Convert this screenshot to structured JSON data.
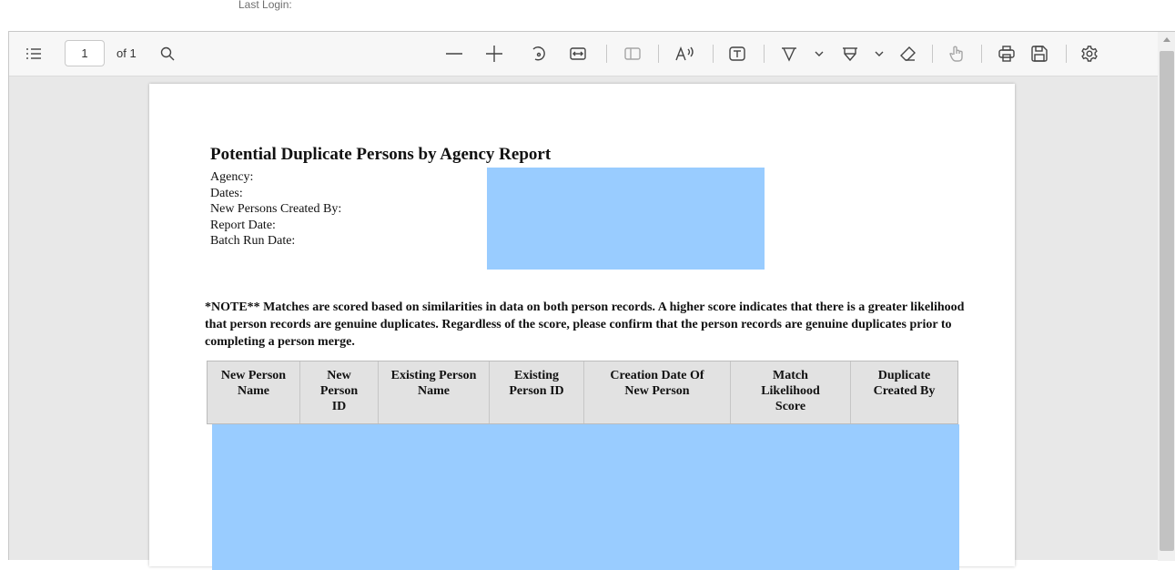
{
  "top": {
    "last_login_label": "Last Login:"
  },
  "toolbar": {
    "page_number": "1",
    "page_of": "of 1",
    "colors": {
      "toolbar_bg": "#f7f7f7",
      "viewer_bg": "#e8e8e8",
      "redaction": "#99ccff"
    },
    "icons": [
      "contents-icon",
      "search-icon",
      "zoom-out-icon",
      "zoom-in-icon",
      "rotate-icon",
      "fit-width-icon",
      "page-view-icon",
      "read-aloud-icon",
      "text-box-icon",
      "draw-icon",
      "highlight-icon",
      "eraser-icon",
      "touch-icon",
      "print-icon",
      "save-icon",
      "settings-icon"
    ]
  },
  "document": {
    "title": "Potential Duplicate Persons by Agency Report",
    "meta_labels": [
      "Agency:",
      "Dates:",
      "New Persons Created By:",
      "Report Date:",
      "Batch Run Date:"
    ],
    "note": "*NOTE** Matches are scored based on similarities in data on both person records.  A higher score indicates that there is a greater likelihood that person records are genuine duplicates. Regardless of the score, please confirm that the person records are genuine duplicates prior to completing a person merge.",
    "table_headers": [
      "New Person Name",
      "New Person ID",
      "Existing Person Name",
      "Existing Person ID",
      "Creation Date Of New Person",
      "Match Likelihood Score",
      "Duplicate Created By"
    ]
  }
}
